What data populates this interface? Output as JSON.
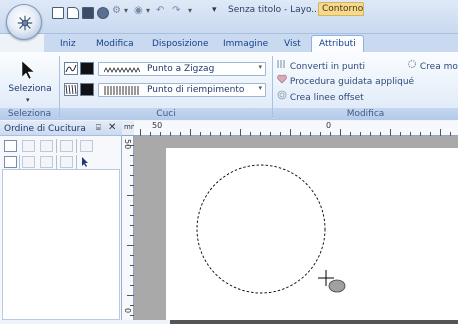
{
  "window": {
    "title": "Senza titolo - Layo...",
    "context_group": "Contorno"
  },
  "tabs": [
    {
      "label": "Iniz",
      "active": false
    },
    {
      "label": "Modifica",
      "active": false
    },
    {
      "label": "Disposizione",
      "active": false
    },
    {
      "label": "Immagine",
      "active": false
    },
    {
      "label": "Vist",
      "active": false
    },
    {
      "label": "Attributi",
      "active": true
    }
  ],
  "ribbon": {
    "select_group": {
      "button_label": "Seleziona",
      "group_label": "Seleziona"
    },
    "stitch_group": {
      "line_combo": "Punto a Zigzag",
      "fill_combo": "Punto di riempimento",
      "group_label": "Cuci"
    },
    "modify_group": {
      "items": [
        {
          "label": "Converti in punti",
          "icon": "convert-stitch-icon"
        },
        {
          "label": "Procedura guidata appliqué",
          "icon": "applique-wizard-icon"
        },
        {
          "label": "Crea linee offset",
          "icon": "offset-lines-icon"
        }
      ],
      "extra_item": "Crea moti",
      "group_label": "Modifica"
    }
  },
  "panel": {
    "title": "Ordine di Cucitura",
    "pin": "⌸",
    "close": "✕"
  },
  "rulers": {
    "top_labels": [
      "50",
      "0"
    ],
    "left_labels": [
      "50",
      "0"
    ]
  },
  "colors": {
    "ribbon_bg": "#dce8f7",
    "context_tab": "#f4d98e",
    "canvas_bg": "#a9a9a9",
    "page": "#ffffff"
  }
}
